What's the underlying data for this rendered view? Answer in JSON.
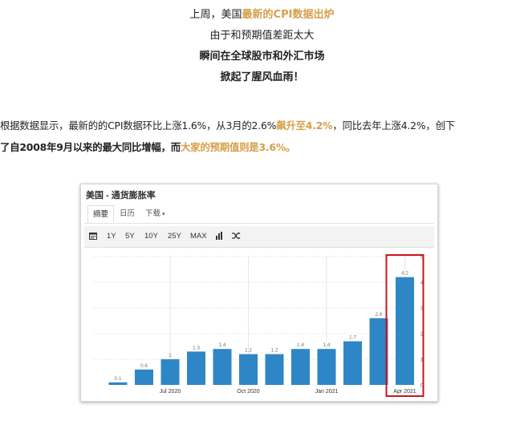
{
  "intro": {
    "line1": {
      "a": "上周，美国",
      "b": "最新的CPI数据出炉"
    },
    "line2": "由于和预期值差距太大",
    "line3": "瞬间在全球股市和外汇市场",
    "line4": "掀起了腥风血雨！"
  },
  "paragraph": {
    "p1": "根据数据显示，最新的的CPI数据环比上涨1.6%，从3月的2.6%",
    "p2": "飙升至4.2%",
    "p3": "，同比去年上涨4.2%，创下",
    "p4": "了自2008年9月以来的最大同比增幅，而",
    "p5": "大家的预期值则是3.6%。"
  },
  "widget": {
    "title": "美国 - 通货膨胀率",
    "tabs": [
      {
        "label": "摘要"
      },
      {
        "label": "日历"
      },
      {
        "label": "下载",
        "caret": "▾"
      }
    ],
    "toolbar": {
      "ranges": [
        "1Y",
        "5Y",
        "10Y",
        "25Y",
        "MAX"
      ],
      "icons": [
        "calendar-icon",
        "bar-chart-icon",
        "shuffle-icon"
      ]
    }
  },
  "chart_data": {
    "type": "bar",
    "categories": [
      "",
      "",
      "",
      "Jul 2020",
      "",
      "",
      "Oct 2020",
      "",
      "",
      "Jan 2021",
      "",
      "",
      "Apr 2021"
    ],
    "values": [
      0.1,
      0.6,
      1,
      1.3,
      1.4,
      1.2,
      1.2,
      1.4,
      1.4,
      1.7,
      2.6,
      4.2
    ],
    "data_labels": [
      "0.1",
      "0.6",
      "1",
      "1.3",
      "1.4",
      "1.2",
      "1.2",
      "1.4",
      "1.4",
      "1.7",
      "2.6",
      "4.2"
    ],
    "x_ticks": [
      "Jul 2020",
      "Oct 2020",
      "Jan 2021",
      "Apr 2021"
    ],
    "y_ticks": [
      0,
      1,
      2,
      3,
      4,
      5
    ],
    "ylim": [
      0,
      5
    ],
    "bar_color": "#2f86c7",
    "highlight_color": "#c9141c",
    "grid": true
  }
}
